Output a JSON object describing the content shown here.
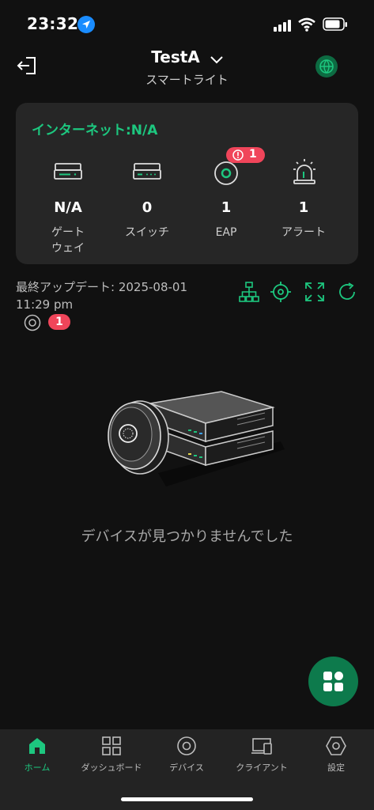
{
  "status_bar": {
    "time": "23:32"
  },
  "header": {
    "title": "TestA",
    "subtitle": "スマートライト"
  },
  "summary": {
    "internet": "インターネット:N/A",
    "stats": [
      {
        "value": "N/A",
        "label": "ゲート\nウェイ",
        "icon": "gateway-icon"
      },
      {
        "value": "0",
        "label": "スイッチ",
        "icon": "switch-icon"
      },
      {
        "value": "1",
        "label": "EAP",
        "icon": "eap-icon",
        "alert_count": "1"
      },
      {
        "value": "1",
        "label": "アラート",
        "icon": "alarm-icon"
      }
    ]
  },
  "last_update": "最終アップデート: 2025-08-01 11:29 pm",
  "eap_filter_count": "1",
  "empty_message": "デバイスが見つかりませんでした",
  "tabs": [
    {
      "label": "ホーム",
      "icon": "home-icon",
      "active": true
    },
    {
      "label": "ダッシュボード",
      "icon": "dashboard-icon"
    },
    {
      "label": "デバイス",
      "icon": "device-icon"
    },
    {
      "label": "クライアント",
      "icon": "client-icon"
    },
    {
      "label": "設定",
      "icon": "settings-icon"
    }
  ],
  "colors": {
    "accent": "#1dc77f",
    "alert": "#f0455a",
    "background": "#111111",
    "card": "#262626"
  }
}
